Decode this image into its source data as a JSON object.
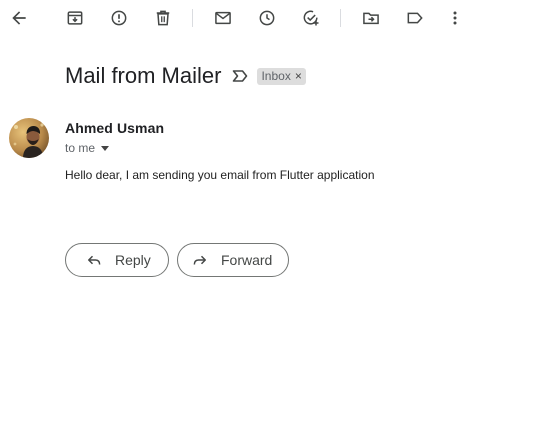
{
  "toolbar": {
    "icons": [
      "back-icon",
      "archive-icon",
      "report-spam-icon",
      "delete-icon",
      "mark-unread-icon",
      "snooze-icon",
      "add-task-icon",
      "move-to-icon",
      "labels-icon",
      "more-icon"
    ]
  },
  "email": {
    "subject": "Mail from Mailer",
    "label": "Inbox",
    "label_remove": "×",
    "sender": "Ahmed Usman",
    "recipient": "to me",
    "body": "Hello dear, I am sending you email from Flutter application"
  },
  "actions": {
    "reply_label": "Reply",
    "forward_label": "Forward"
  },
  "colors": {
    "icon": "#444746",
    "chip_bg": "#dddddd",
    "border": "#747775"
  }
}
